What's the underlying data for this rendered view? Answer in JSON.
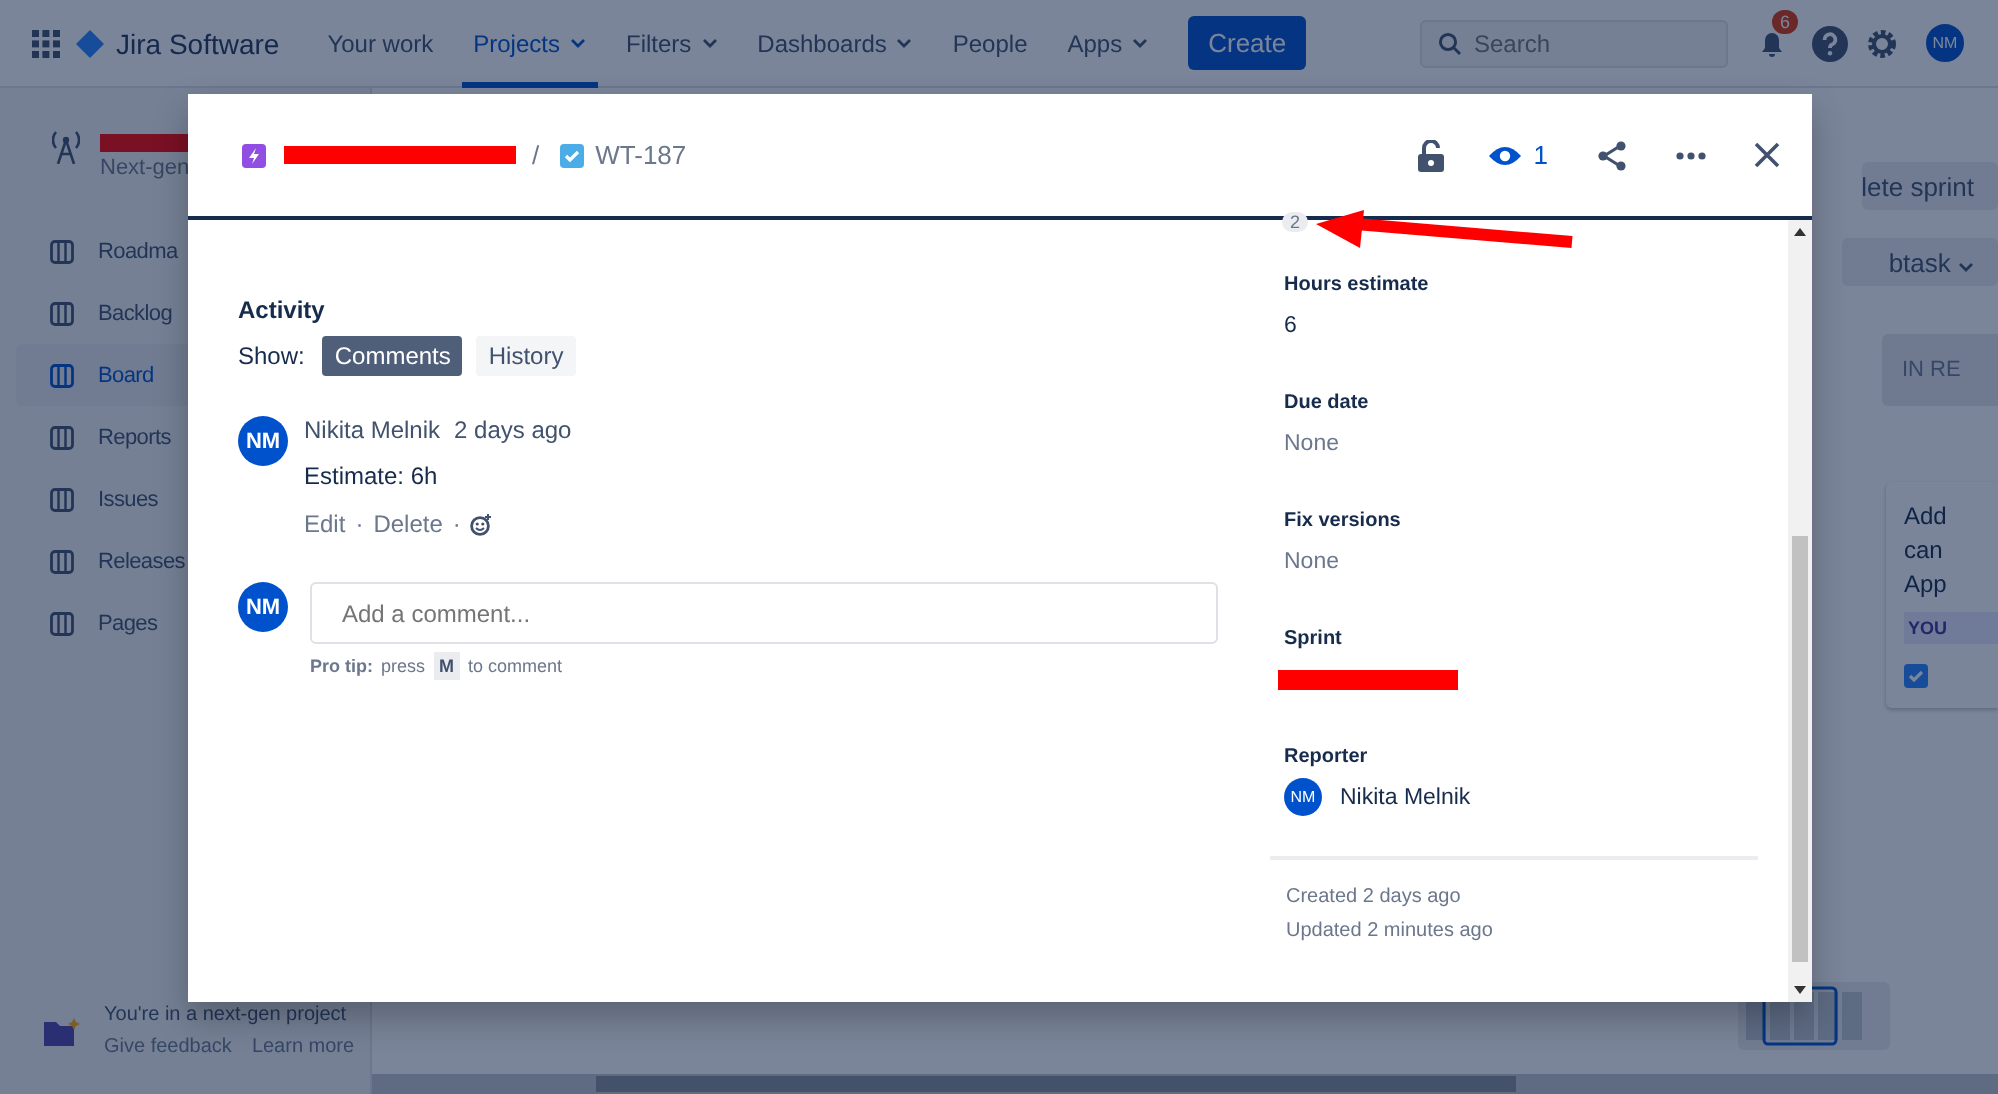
{
  "top_nav": {
    "product": "Jira Software",
    "items": [
      {
        "label": "Your work",
        "selected": false,
        "dropdown": false
      },
      {
        "label": "Projects",
        "selected": true,
        "dropdown": true
      },
      {
        "label": "Filters",
        "selected": false,
        "dropdown": true
      },
      {
        "label": "Dashboards",
        "selected": false,
        "dropdown": true
      },
      {
        "label": "People",
        "selected": false,
        "dropdown": false
      },
      {
        "label": "Apps",
        "selected": false,
        "dropdown": true
      }
    ],
    "create": "Create",
    "search": {
      "placeholder": "Search"
    },
    "notifications_badge": "6",
    "avatar": "NM"
  },
  "sidebar": {
    "project_subtitle": "Next-gen",
    "items": [
      {
        "label": "Roadma",
        "selected": false
      },
      {
        "label": "Backlog",
        "selected": false
      },
      {
        "label": "Board",
        "selected": true
      },
      {
        "label": "Reports",
        "selected": false
      },
      {
        "label": "Issues",
        "selected": false
      },
      {
        "label": "Releases",
        "selected": false
      },
      {
        "label": "Pages",
        "selected": false
      }
    ],
    "footer": {
      "text": "You're in a next-gen project",
      "links": [
        "Give feedback",
        "Learn more"
      ]
    }
  },
  "board": {
    "complete_sprint": "lete sprint",
    "subtask_button": "btask",
    "column_header": "IN RE",
    "card_lines": [
      "Add",
      "can",
      "App"
    ],
    "card_tag": "YOU"
  },
  "modal": {
    "breadcrumb": {
      "separator": "/",
      "issue_key": "WT-187"
    },
    "watchers": "1",
    "activity": {
      "title": "Activity",
      "show_label": "Show:",
      "filters": [
        {
          "label": "Comments",
          "selected": true
        },
        {
          "label": "History",
          "selected": false
        }
      ],
      "comments": [
        {
          "avatar": "NM",
          "author": "Nikita Melnik",
          "time": "2 days ago",
          "body": "Estimate: 6h",
          "actions": [
            "Edit",
            "Delete"
          ],
          "action_separator": "·"
        }
      ],
      "new_comment": {
        "avatar": "NM",
        "placeholder": "Add a comment...",
        "tip_label": "Pro tip:",
        "tip_before": "press",
        "tip_key": "M",
        "tip_after": "to comment"
      }
    },
    "details": {
      "count_badge": "2",
      "fields": [
        {
          "label": "Hours estimate",
          "kind": "text",
          "value": "6"
        },
        {
          "label": "Due date",
          "kind": "empty",
          "value": "None"
        },
        {
          "label": "Fix versions",
          "kind": "empty",
          "value": "None"
        },
        {
          "label": "Sprint",
          "kind": "redacted"
        },
        {
          "label": "Reporter",
          "kind": "user",
          "avatar": "NM",
          "value": "Nikita Melnik"
        }
      ],
      "created": "Created 2 days ago",
      "updated": "Updated 2 minutes ago"
    }
  }
}
